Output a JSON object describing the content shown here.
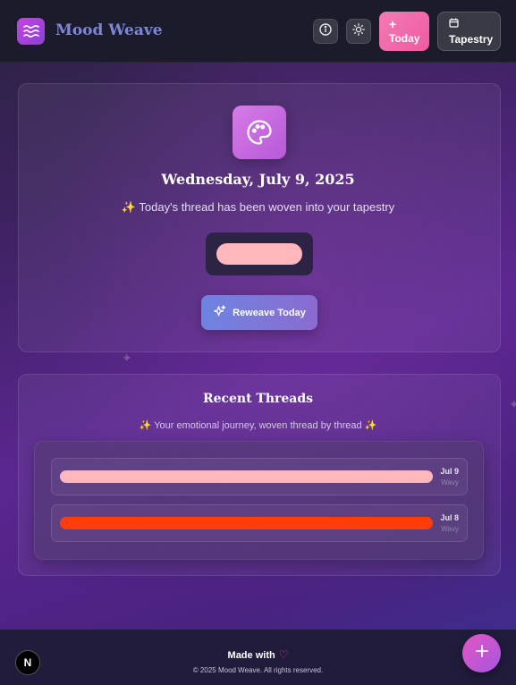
{
  "app": {
    "name": "Mood Weave",
    "logo_icon": "waves-icon"
  },
  "header": {
    "info_icon": "info-icon",
    "theme_icon": "sun-icon",
    "today_button": {
      "icon": "plus-icon",
      "label": "Today"
    },
    "tapestry_button": {
      "icon": "calendar-icon",
      "label": "Tapestry"
    }
  },
  "today_card": {
    "icon": "palette-icon",
    "date": "Wednesday, July 9, 2025",
    "status_emoji": "✨",
    "status_text": "Today's thread has been woven into your tapestry",
    "swatch_color": "#ffb6bd",
    "reweave_button": {
      "icon": "sparkles-icon",
      "label": "Reweave Today"
    }
  },
  "recent": {
    "title": "Recent Threads",
    "subtitle": "✨ Your emotional journey, woven thread by thread ✨",
    "threads": [
      {
        "date": "Jul 9",
        "style": "Wavy",
        "color": "#ffb6bd"
      },
      {
        "date": "Jul 8",
        "style": "Wavy",
        "color": "#ff3d0a"
      }
    ]
  },
  "footer": {
    "made_with": "Made with",
    "heart_icon": "heart-icon",
    "copyright": "© 2025 Mood Weave. All rights reserved."
  },
  "dev_badge": {
    "label": "N"
  },
  "fab": {
    "icon": "plus-icon"
  }
}
